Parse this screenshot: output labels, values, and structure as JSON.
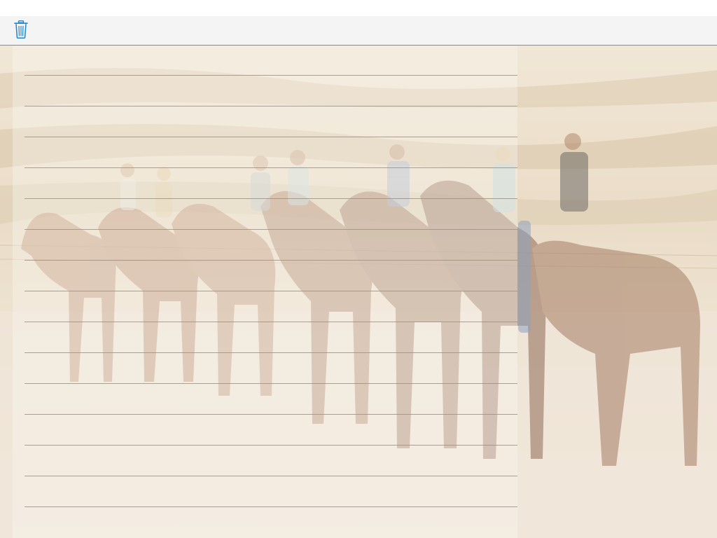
{
  "toolbar": {
    "trash_icon": "trash-icon",
    "accent_color": "#1a86d6"
  },
  "background_image": {
    "subject": "riders-on-horseback-in-desert"
  },
  "notepad": {
    "ruled_line_count": 15,
    "ruled_line_color": "#9a9286"
  }
}
